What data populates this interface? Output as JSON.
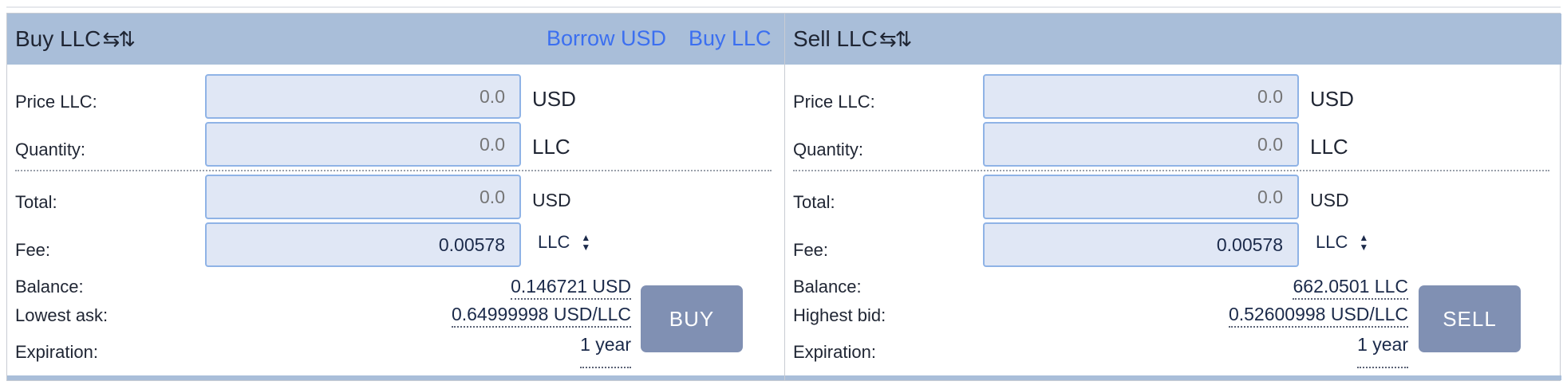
{
  "buy": {
    "title": "Buy LLC",
    "title_icon": "⇆⇅",
    "links": [
      {
        "label": "Borrow USD"
      },
      {
        "label": "Buy LLC"
      }
    ],
    "price_label": "Price LLC:",
    "price_placeholder": "0.0",
    "price_unit": "USD",
    "quantity_label": "Quantity:",
    "quantity_placeholder": "0.0",
    "quantity_unit": "LLC",
    "total_label": "Total:",
    "total_placeholder": "0.0",
    "total_unit": "USD",
    "fee_label": "Fee:",
    "fee_value": "0.00578",
    "fee_asset": "LLC",
    "balance_label": "Balance:",
    "balance_value": "0.146721 USD",
    "market_label": "Lowest ask:",
    "market_value": "0.64999998 USD/LLC",
    "expiration_label": "Expiration:",
    "expiration_value": "1 year",
    "action_label": "BUY"
  },
  "sell": {
    "title": "Sell LLC",
    "title_icon": "⇆⇅",
    "price_label": "Price LLC:",
    "price_placeholder": "0.0",
    "price_unit": "USD",
    "quantity_label": "Quantity:",
    "quantity_placeholder": "0.0",
    "quantity_unit": "LLC",
    "total_label": "Total:",
    "total_placeholder": "0.0",
    "total_unit": "USD",
    "fee_label": "Fee:",
    "fee_value": "0.00578",
    "fee_asset": "LLC",
    "balance_label": "Balance:",
    "balance_value": "662.0501 LLC",
    "market_label": "Highest bid:",
    "market_value": "0.52600998 USD/LLC",
    "expiration_label": "Expiration:",
    "expiration_value": "1 year",
    "action_label": "SELL"
  },
  "colors": {
    "header_bg": "#a9bed9",
    "link": "#3b6ff0",
    "field_bg": "#e0e7f5",
    "field_border": "#8fb3e6",
    "button_bg": "#8090b3"
  }
}
